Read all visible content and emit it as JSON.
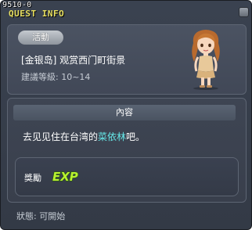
{
  "window": {
    "quest_id": "9510-0",
    "title": "QUEST INFO"
  },
  "quest": {
    "badge": "活動",
    "name": "[金银岛] 观赏西门町街景",
    "level": "建議等級: 10~14"
  },
  "content": {
    "header": "內容",
    "text_before": "去见见住在台湾的",
    "npc_name": "菜依林",
    "text_after": "吧。"
  },
  "reward": {
    "label": "獎勵",
    "exp_text": "EXP"
  },
  "status": {
    "text": "狀態: 可開始"
  },
  "colors": {
    "title": "#e8e060",
    "npc_link": "#66e8e8",
    "exp_fill": "#b8f030",
    "exp_outline": "#2a5a10"
  },
  "icons": {
    "close": "close-icon",
    "npc": "npc-portrait",
    "exp": "exp-icon"
  }
}
